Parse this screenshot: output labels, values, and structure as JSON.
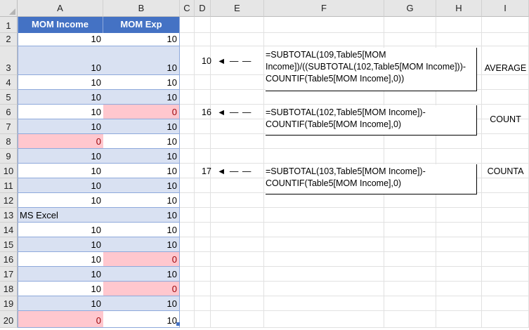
{
  "columns": [
    "A",
    "B",
    "C",
    "D",
    "E",
    "F",
    "G",
    "H",
    "I"
  ],
  "rows": [
    "1",
    "2",
    "3",
    "4",
    "5",
    "6",
    "7",
    "8",
    "9",
    "10",
    "11",
    "12",
    "13",
    "14",
    "15",
    "16",
    "17",
    "18",
    "19",
    "20"
  ],
  "table": {
    "headers": [
      "MOM Income",
      "MOM Exp"
    ],
    "a": [
      "10",
      "10",
      "10",
      "10",
      "10",
      "10",
      "0",
      "10",
      "10",
      "10",
      "10",
      "MS Excel",
      "10",
      "10",
      "10",
      "10",
      "10",
      "10",
      "0"
    ],
    "b": [
      "10",
      "10",
      "10",
      "10",
      "0",
      "10",
      "10",
      "10",
      "10",
      "10",
      "10",
      "10",
      "10",
      "10",
      "0",
      "10",
      "0",
      "10",
      "10"
    ]
  },
  "formulas": [
    {
      "result": "10",
      "text": "=SUBTOTAL(109,Table5[MOM\nIncome])/((SUBTOTAL(102,Table5[MOM Income]))-\nCOUNTIF(Table5[MOM Income],0))",
      "label": "AVERAGE"
    },
    {
      "result": "16",
      "text": "=SUBTOTAL(102,Table5[MOM Income])-\nCOUNTIF(Table5[MOM Income],0)",
      "label": "COUNT"
    },
    {
      "result": "17",
      "text": "=SUBTOTAL(103,Table5[MOM Income])-\nCOUNTIF(Table5[MOM Income],0)",
      "label": "COUNTA"
    }
  ],
  "arrow_glyph": "◄ — —",
  "colors": {
    "header_blue": "#4472c4",
    "band_blue": "#d9e1f2",
    "bad_fill": "#ffc7ce",
    "bad_text": "#9c0006"
  }
}
